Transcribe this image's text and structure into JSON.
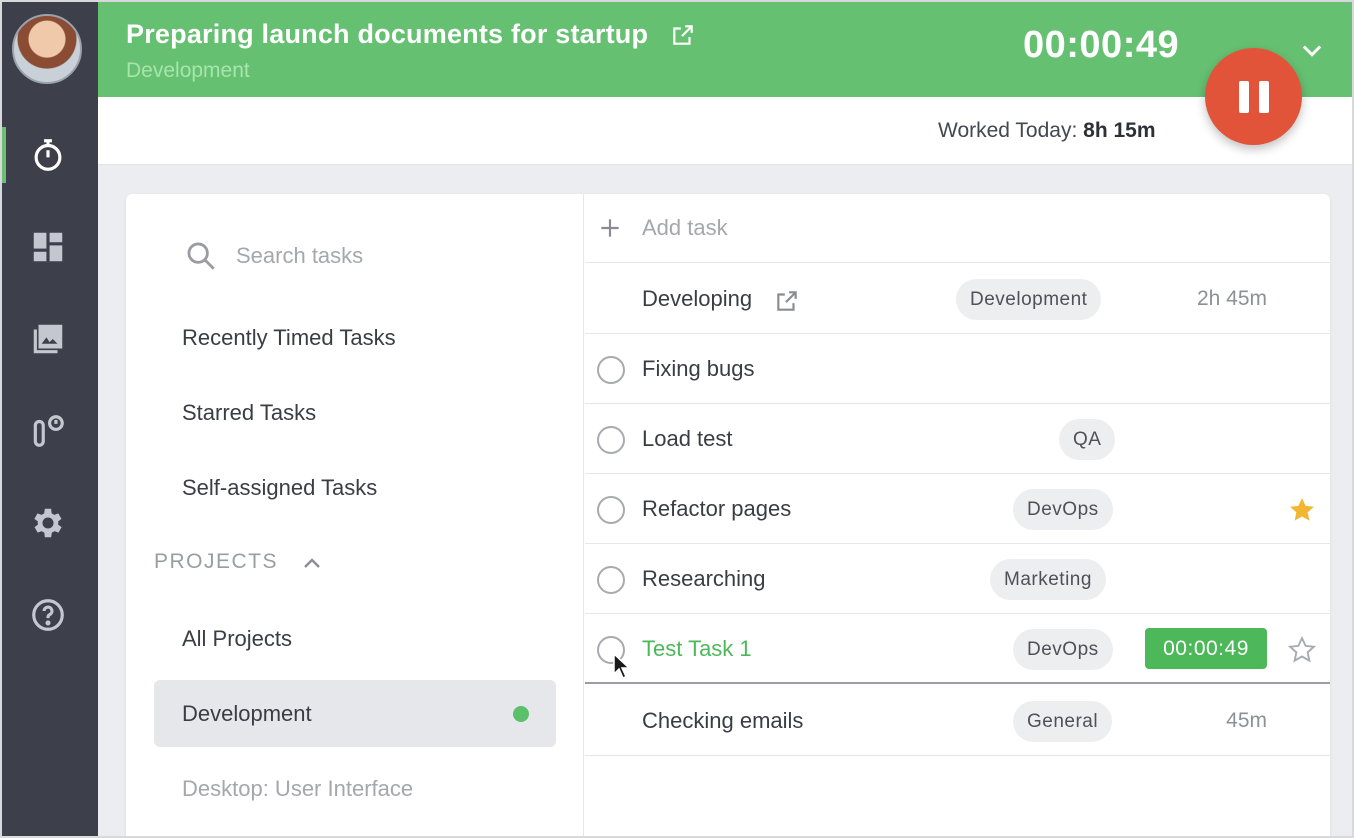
{
  "header": {
    "task_title": "Preparing launch documents for startup",
    "task_project": "Development",
    "timer": "00:00:49",
    "worked_today_label": "Worked Today:",
    "worked_today_value": "8h 15m"
  },
  "sidebar": {
    "items": [
      {
        "name": "timer-icon",
        "active": true
      },
      {
        "name": "dashboard-icon",
        "active": false
      },
      {
        "name": "screenshots-icon",
        "active": false
      },
      {
        "name": "integrations-icon",
        "active": false
      },
      {
        "name": "settings-icon",
        "active": false
      },
      {
        "name": "help-icon",
        "active": false
      }
    ]
  },
  "left_panel": {
    "search_placeholder": "Search tasks",
    "items": [
      "Recently Timed Tasks",
      "Starred Tasks",
      "Self-assigned Tasks"
    ],
    "projects_heading": "PROJECTS",
    "projects": [
      "All Projects",
      "Development",
      "Desktop: User Interface"
    ],
    "selected_project": "Development"
  },
  "tasks": {
    "add_label": "Add task",
    "rows": [
      {
        "name": "Developing",
        "tag": "Development",
        "duration": "2h 45m",
        "checkbox": false,
        "external_link": true
      },
      {
        "name": "Fixing bugs",
        "tag": "",
        "duration": "",
        "checkbox": true
      },
      {
        "name": "Load test",
        "tag": "QA",
        "duration": "",
        "checkbox": true
      },
      {
        "name": "Refactor pages",
        "tag": "DevOps",
        "duration": "",
        "checkbox": true,
        "starred": true
      },
      {
        "name": "Researching",
        "tag": "Marketing",
        "duration": "",
        "checkbox": true
      },
      {
        "name": "Test Task 1",
        "tag": "DevOps",
        "timer": "00:00:49",
        "checkbox": true,
        "starred": false,
        "active": true
      },
      {
        "name": "Checking emails",
        "tag": "General",
        "duration": "45m",
        "checkbox": false
      }
    ]
  },
  "colors": {
    "accent_green": "#66c072",
    "pause_button": "#e2543a",
    "star_filled": "#f2b630",
    "sidebar_bg": "#3d3f4a"
  }
}
